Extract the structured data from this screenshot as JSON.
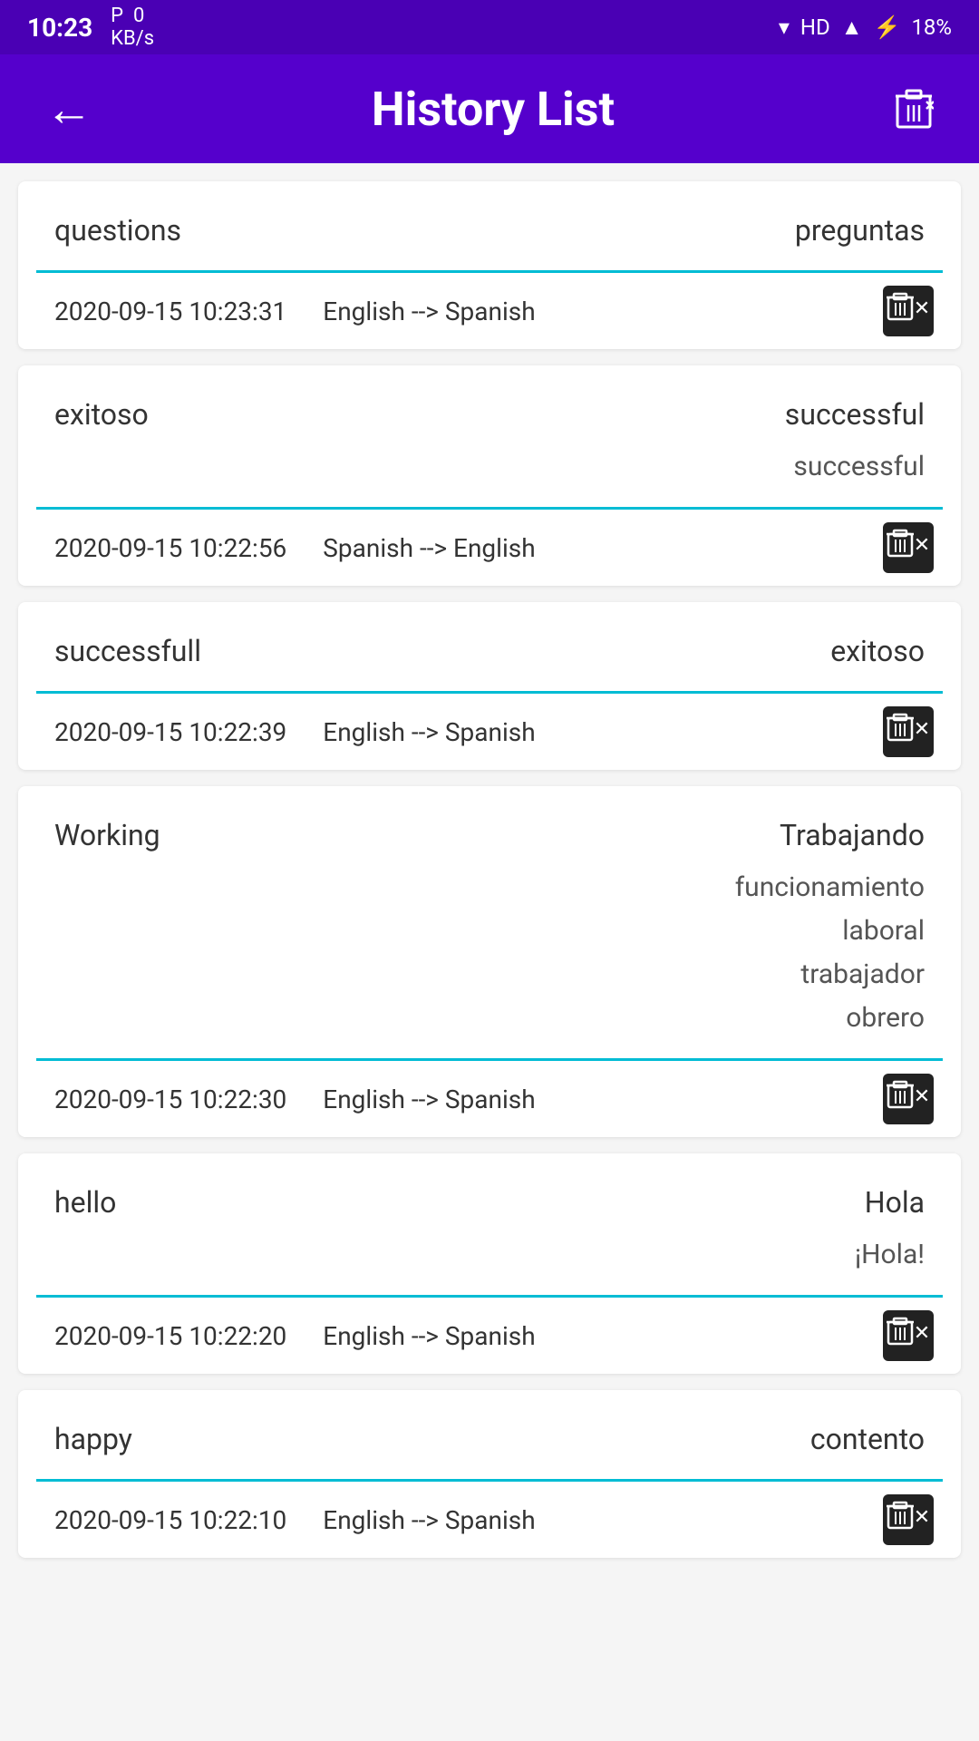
{
  "statusBar": {
    "time": "10:23",
    "networkLabel": "0\nKB/s",
    "signal": "HD",
    "battery": "18%"
  },
  "appBar": {
    "title": "History List",
    "backLabel": "←",
    "clearAllLabel": "🗑≡"
  },
  "historyItems": [
    {
      "id": 1,
      "source": "questions",
      "primaryTranslation": "preguntas",
      "altTranslations": [],
      "timestamp": "2020-09-15 10:23:31",
      "direction": "English --> Spanish"
    },
    {
      "id": 2,
      "source": "exitoso",
      "primaryTranslation": "successful",
      "altTranslations": [
        "successful"
      ],
      "timestamp": "2020-09-15 10:22:56",
      "direction": "Spanish --> English"
    },
    {
      "id": 3,
      "source": "successfull",
      "primaryTranslation": "exitoso",
      "altTranslations": [],
      "timestamp": "2020-09-15 10:22:39",
      "direction": "English --> Spanish"
    },
    {
      "id": 4,
      "source": "Working",
      "primaryTranslation": "Trabajando",
      "altTranslations": [
        "funcionamiento",
        "laboral",
        "trabajador",
        "obrero"
      ],
      "timestamp": "2020-09-15 10:22:30",
      "direction": "English --> Spanish"
    },
    {
      "id": 5,
      "source": "hello",
      "primaryTranslation": "Hola",
      "altTranslations": [
        "¡Hola!"
      ],
      "timestamp": "2020-09-15 10:22:20",
      "direction": "English --> Spanish"
    },
    {
      "id": 6,
      "source": "happy",
      "primaryTranslation": "contento",
      "altTranslations": [],
      "timestamp": "2020-09-15 10:22:10",
      "direction": "English --> Spanish"
    }
  ]
}
